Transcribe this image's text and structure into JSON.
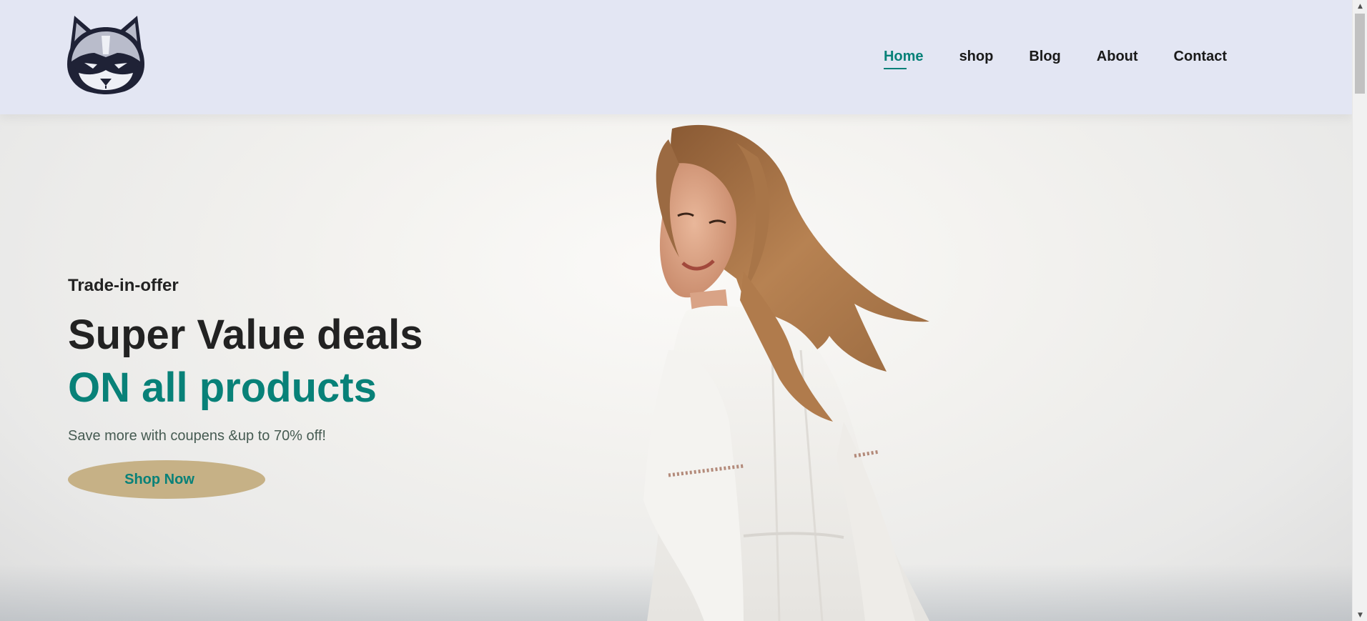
{
  "header": {
    "logo_icon": "raccoon-logo-icon",
    "nav": [
      {
        "label": "Home",
        "active": true
      },
      {
        "label": "shop",
        "active": false
      },
      {
        "label": "Blog",
        "active": false
      },
      {
        "label": "About",
        "active": false
      },
      {
        "label": "Contact",
        "active": false
      }
    ]
  },
  "hero": {
    "eyebrow": "Trade-in-offer",
    "title": "Super Value deals",
    "subtitle": "ON all products",
    "description": "Save more with coupens &up to 70% off!",
    "cta_label": "Shop Now",
    "image_icon": "woman-in-white-dress-photo"
  },
  "colors": {
    "header_bg": "#e3e6f3",
    "accent": "#088178",
    "button_bg": "#c6b186",
    "text_dark": "#222222"
  },
  "scrollbar": {
    "up_icon": "scroll-up-arrow-icon",
    "down_icon": "scroll-down-arrow-icon"
  }
}
